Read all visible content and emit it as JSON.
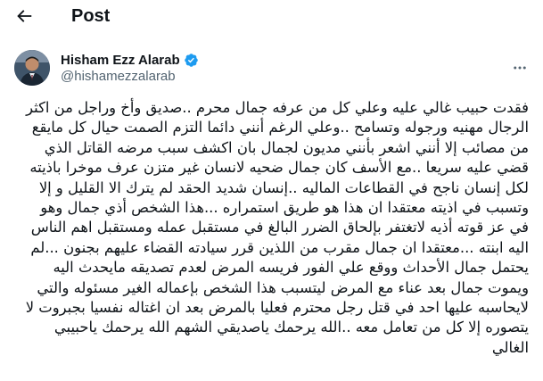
{
  "header": {
    "title": "Post",
    "back_icon": "arrow-left-icon"
  },
  "author": {
    "display_name": "Hisham Ezz Alarab",
    "handle": "@hishamezzalarab",
    "verified_color": "#1d9bf0",
    "more_icon": "ellipsis-icon"
  },
  "post": {
    "lines": [
      "فقدت حبيب غالي عليه وعلي كل من عرفه جمال محرم ..صديق وأخ وراجل من  اكثر",
      "الرجال مهنيه ورجوله وتسامح ..وعلي الرغم أنني دائما التزم الصمت حيال كل مايقع",
      "من مصائب إلا أنني  اشعر بأنني مديون لجمال بان اكشف سبب مرضه القاتل الذي",
      "قضي عليه سريعا  ..مع الأسف كان جمال ضحيه لانسان غير متزن  عرف موخرا باذيته",
      "لكل إنسان ناجح في القطاعات الماليه  ..إنسان شديد الحقد لم يترك الا القليل و إلا",
      "وتسبب في اذيته معتقدا ان هذا هو طريق استمراره ...هذا الشخص أذي جمال وهو",
      "في عز قوته أذيه لاتغتفر بإلحاق الضرر البالغ في مستقبل عمله ومستقبل اهم الناس",
      "اليه ابنته ...معتقدا ان جمال  مقرب من اللذين قرر سيادته القضاء عليهم بجنون ...لم",
      "يحتمل جمال الأحداث ووقع علي الفور فريسه المرض لعدم تصديقه مايحدث اليه",
      "ويموت جمال بعد عناء مع المرض ليتسبب هذا الشخص بإعماله الغير مسئوله والتي",
      "لايحاسبه عليها احد في قتل رجل محترم فعليا بالمرض بعد ان اغتاله نفسيا بجبروت لا",
      "يتصوره إلا كل من تعامل معه ..الله يرحمك ياصديقي الشهم  الله يرحمك ياحبيبي",
      "الغالي"
    ]
  }
}
